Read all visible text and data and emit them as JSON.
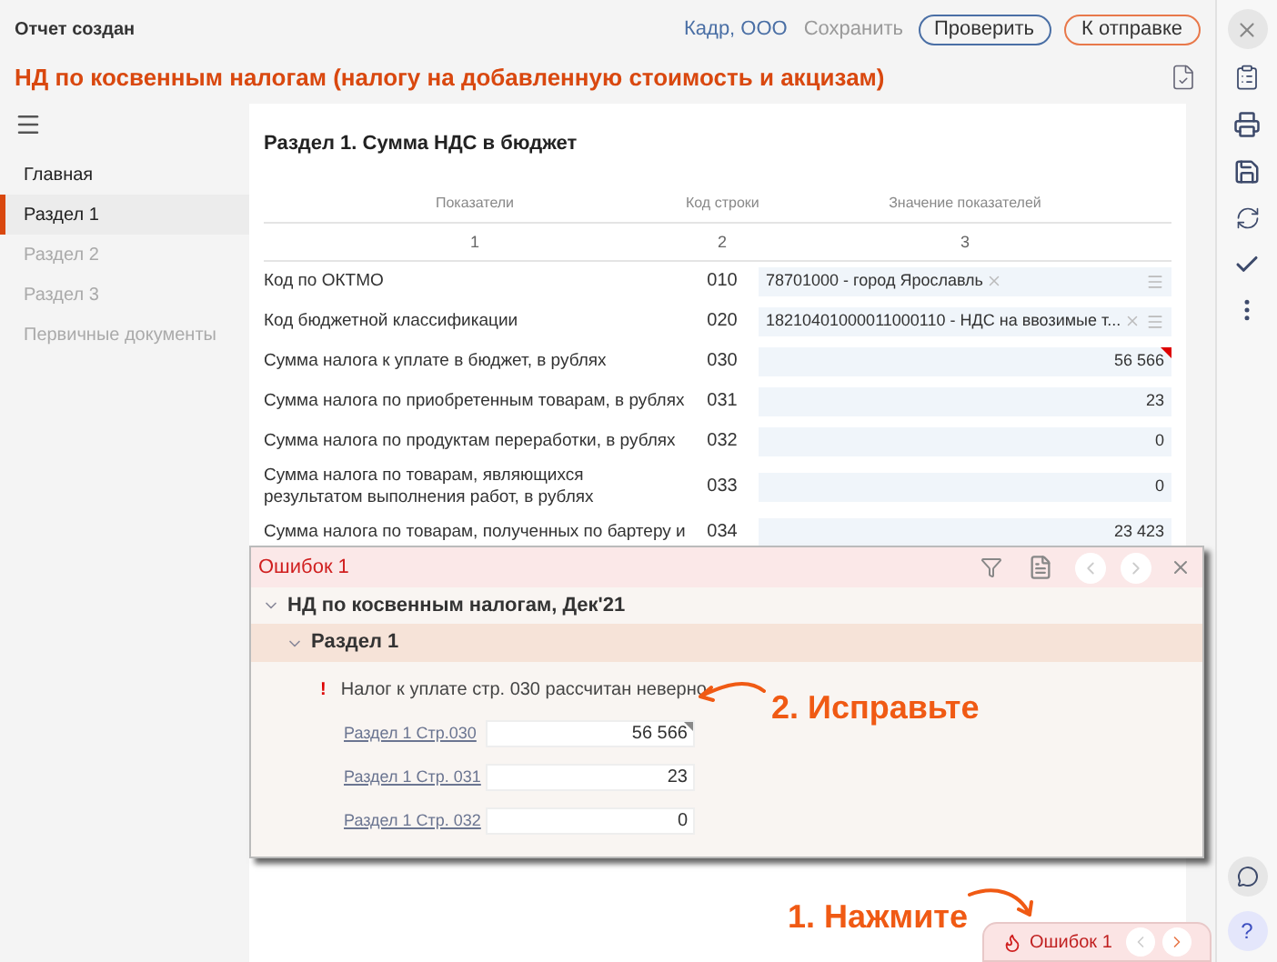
{
  "header": {
    "status": "Отчет создан",
    "org": "Кадр, ООО",
    "save": "Сохранить",
    "check_button": "Проверить",
    "send_button": "К отправке",
    "title": "НД по косвенным налогам (налогу на добавленную стоимость и акцизам)"
  },
  "sidebar": {
    "items": [
      {
        "label": "Главная",
        "selected": false,
        "disabled": false
      },
      {
        "label": "Раздел 1",
        "selected": true,
        "disabled": false
      },
      {
        "label": "Раздел 2",
        "selected": false,
        "disabled": true
      },
      {
        "label": "Раздел 3",
        "selected": false,
        "disabled": true
      },
      {
        "label": "Первичные документы",
        "selected": false,
        "disabled": true
      }
    ]
  },
  "section": {
    "title": "Раздел 1. Сумма НДС в бюджет",
    "columns": [
      {
        "heading": "Показатели",
        "number": "1"
      },
      {
        "heading": "Код строки",
        "number": "2"
      },
      {
        "heading": "Значение показателей",
        "number": "3"
      }
    ],
    "rows": [
      {
        "label": "Код по ОКТМО",
        "code": "010",
        "kind": "select",
        "value": "78701000 - город Ярославль",
        "error": false
      },
      {
        "label": "Код бюджетной классификации",
        "code": "020",
        "kind": "select",
        "value": "18210401000011000110 - НДС на ввозимые т...",
        "error": false
      },
      {
        "label": "Сумма налога к уплате в бюджет, в рублях",
        "code": "030",
        "kind": "number",
        "value": "56 566",
        "error": true
      },
      {
        "label": "Сумма налога по приобретенным товарам, в рублях",
        "code": "031",
        "kind": "number",
        "value": "23",
        "error": false
      },
      {
        "label": "Сумма налога по продуктам переработки, в рублях",
        "code": "032",
        "kind": "number",
        "value": "0",
        "error": false
      },
      {
        "label": "Сумма налога по товарам, являющихся результатом выполнения работ, в рублях",
        "code": "033",
        "kind": "number",
        "value": "0",
        "error": false
      },
      {
        "label": "Сумма налога по товарам, полученных по бартеру и",
        "code": "034",
        "kind": "number",
        "value": "23 423",
        "error": false
      }
    ]
  },
  "errors_panel": {
    "title": "Ошибок 1",
    "report": "НД по косвенным налогам, Дек'21",
    "report_expanded": true,
    "section": "Раздел 1",
    "section_expanded": true,
    "error_mark": "!",
    "message": "Налог к уплате стр. 030 рассчитан неверно",
    "fields": [
      {
        "link": "Раздел 1 Стр.030",
        "value": "56 566",
        "flagged": true
      },
      {
        "link": "Раздел 1 Стр. 031",
        "value": "23",
        "flagged": false
      },
      {
        "link": "Раздел 1 Стр. 032",
        "value": "0",
        "flagged": false
      }
    ]
  },
  "annotations": [
    {
      "text": "2. Исправьте"
    },
    {
      "text": "1. Нажмите"
    }
  ],
  "error_tab": {
    "label": "Ошибок 1"
  },
  "help": "?"
}
